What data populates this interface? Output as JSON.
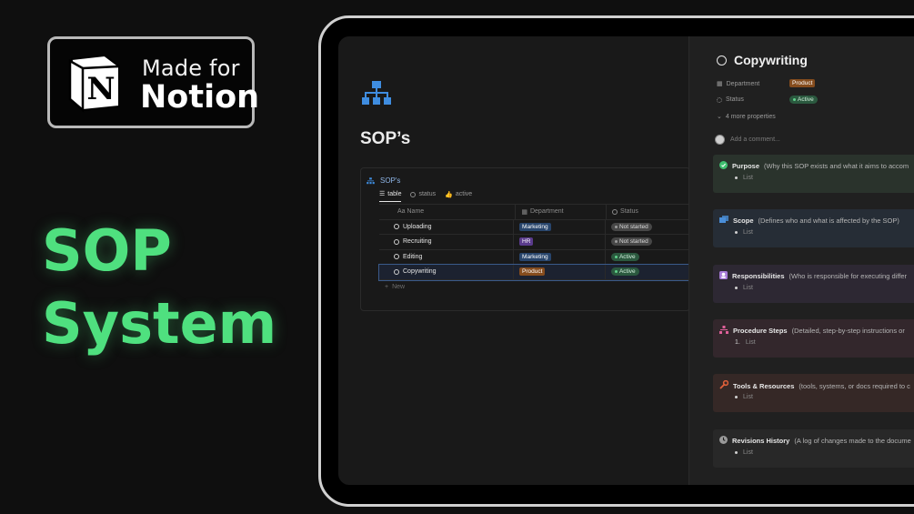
{
  "badge": {
    "line1": "Made for",
    "line2": "Notion"
  },
  "hero": {
    "line1": "SOP",
    "line2": "System"
  },
  "page": {
    "title": "SOP’s"
  },
  "database": {
    "name": "SOP's",
    "tabs": [
      {
        "label": "table",
        "icon": "table-icon",
        "active": true
      },
      {
        "label": "status",
        "icon": "status-circle-icon",
        "active": false
      },
      {
        "label": "active",
        "icon": "thumbs-up-icon",
        "active": false
      }
    ],
    "columns": [
      "Aa Name",
      "Department",
      "Status"
    ],
    "rows": [
      {
        "name": "Uploading",
        "department": "Marketing",
        "status": "Not started"
      },
      {
        "name": "Recruiting",
        "department": "HR",
        "status": "Not started"
      },
      {
        "name": "Editing",
        "department": "Marketing",
        "status": "Active"
      },
      {
        "name": "Copywriting",
        "department": "Product",
        "status": "Active"
      }
    ],
    "new_label": "New"
  },
  "side": {
    "title": "Copywriting",
    "props": [
      {
        "label": "Department",
        "value": "Product"
      },
      {
        "label": "Status",
        "value": "Active"
      }
    ],
    "more": "4 more properties",
    "comment": "Add a comment...",
    "sections": [
      {
        "title": "Purpose",
        "desc": "(Why this SOP exists and what it aims to accom",
        "item": "List",
        "marker": "•",
        "icon": "check-circle-icon",
        "color": "#2a332c",
        "iconColor": "#3fbf6f"
      },
      {
        "title": "Scope",
        "desc": "(Defines who and what is affected by the SOP)",
        "item": "List",
        "marker": "•",
        "icon": "folders-icon",
        "color": "#262d36",
        "iconColor": "#4a8ed8"
      },
      {
        "title": "Responsibilities",
        "desc": "(Who is responsible for executing differ",
        "item": "List",
        "marker": "•",
        "icon": "person-badge-icon",
        "color": "#2d2833",
        "iconColor": "#a77ad8"
      },
      {
        "title": "Procedure Steps",
        "desc": "(Detailed, step-by-step instructions or",
        "item": "List",
        "marker": "1.",
        "icon": "hierarchy-icon",
        "color": "#33272c",
        "iconColor": "#e0609a"
      },
      {
        "title": "Tools & Resources",
        "desc": "(tools, systems, or docs required to c",
        "item": "List",
        "marker": "•",
        "icon": "wrench-icon",
        "color": "#352826",
        "iconColor": "#e0603a"
      },
      {
        "title": "Revisions History",
        "desc": "(A log of changes made to the docume",
        "item": "List",
        "marker": "•",
        "icon": "clock-icon",
        "color": "#282828",
        "iconColor": "#9a9a9a"
      }
    ]
  },
  "colors": {
    "accent_green": "#4fe07f",
    "link_blue": "#8fb6e8"
  }
}
